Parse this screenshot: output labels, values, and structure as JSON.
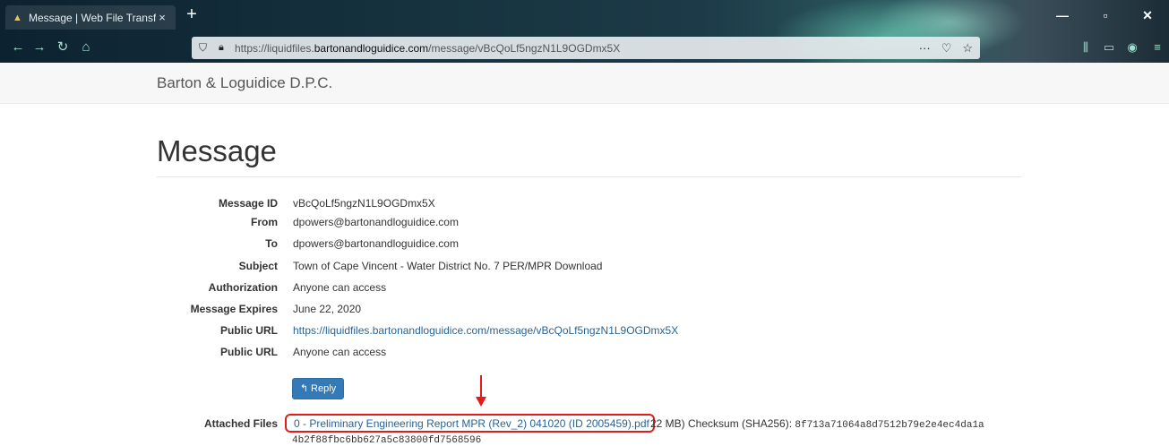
{
  "browser": {
    "tab_title": "Message | Web File Transfer",
    "tab_close": "×",
    "new_tab": "+",
    "url_host_prefix": "https://liquidfiles.",
    "url_host_domain": "bartonandloguidice.com",
    "url_path": "/message/vBcQoLf5ngzN1L9OGDmx5X",
    "url_actions": "···",
    "icons": [
      "tab-favicon-icon",
      "back-icon",
      "forward-icon",
      "reload-icon",
      "home-icon",
      "tracking-shield-icon",
      "lock-icon",
      "pocket-icon",
      "bookmark-star-icon",
      "library-icon",
      "sidebar-icon",
      "account-icon",
      "menu-icon",
      "minimize-icon",
      "maximize-icon",
      "close-window-icon"
    ]
  },
  "site": {
    "brand": "Barton & Loguidice D.P.C."
  },
  "message": {
    "title": "Message",
    "fields": [
      {
        "label": "Message ID",
        "value": "vBcQoLf5ngzN1L9OGDmx5X"
      },
      {
        "label": "From",
        "value": "dpowers@bartonandloguidice.com"
      },
      {
        "label": "To",
        "value": "dpowers@bartonandloguidice.com"
      },
      {
        "label": "Subject",
        "value": "Town of Cape Vincent - Water District No. 7 PER/MPR Download"
      },
      {
        "label": "Authorization",
        "value": "Anyone can access"
      },
      {
        "label": "Message Expires",
        "value": "June 22, 2020"
      },
      {
        "label": "Public URL",
        "value": "https://liquidfiles.bartonandloguidice.com/message/vBcQoLf5ngzN1L9OGDmx5X"
      },
      {
        "label": "Public URL",
        "value": "Anyone can access"
      }
    ],
    "reply_label": "Reply",
    "attached_label": "Attached Files",
    "file_name": "0 - Preliminary Engineering Report MPR (Rev_2) 041020 (ID 2005459).pdf",
    "file_size_text": "22 MB) Checksum (SHA256):",
    "checksum_part1": "8f713a71064a8d7512b79e2e4ec4da1a",
    "checksum_part2": "4b2f88fbc6bb627a5c83800fd7568596"
  },
  "colors": {
    "link": "#2a6496",
    "button": "#337ab7",
    "highlight": "#e41b1b"
  }
}
